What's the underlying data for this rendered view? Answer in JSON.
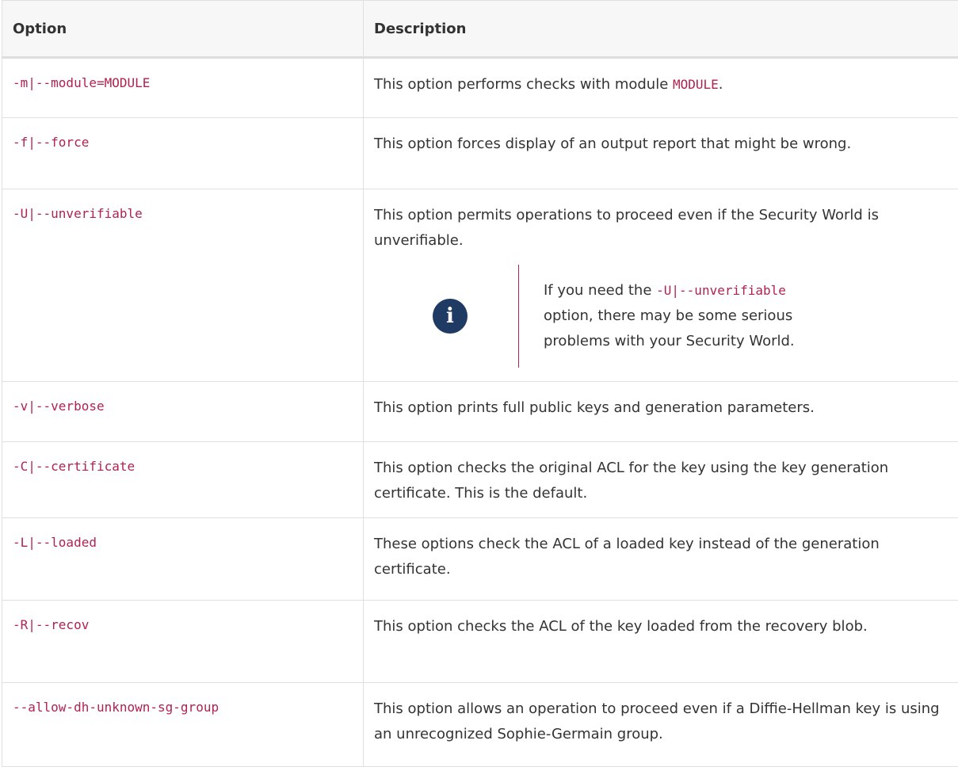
{
  "table": {
    "headers": [
      "Option",
      "Description"
    ],
    "rows": [
      {
        "option": "-m|--module=MODULE",
        "description_prefix": "This option performs checks with module ",
        "description_code": "MODULE",
        "description_suffix": "."
      },
      {
        "option": "-f|--force",
        "description": "This option forces display of an output report that might be wrong."
      },
      {
        "option": "-U|--unverifiable",
        "description": "This option permits operations to proceed even if the Security World is unverifiable.",
        "note": {
          "icon": "info-icon",
          "prefix": "If you need the ",
          "code": "-U|--unverifiable",
          "suffix": " option, there may be some serious problems with your Security World."
        }
      },
      {
        "option": "-v|--verbose",
        "description": "This option prints full public keys and generation parameters."
      },
      {
        "option": "-C|--certificate",
        "description": "This option checks the original ACL for the key using the key generation certificate. This is the default."
      },
      {
        "option": "-L|--loaded",
        "description": "These options check the ACL of a loaded key instead of the generation certificate."
      },
      {
        "option": "-R|--recov",
        "description": "This option checks the ACL of the key loaded from the recovery blob."
      },
      {
        "option": "--allow-dh-unknown-sg-group",
        "description": "This option allows an operation to proceed even if a Diffie-Hellman key is using an unrecognized Sophie-Germain group."
      }
    ]
  },
  "colors": {
    "code": "#b0224f",
    "text": "#333333",
    "header_bg": "#f7f7f7",
    "border": "#e0e0e0",
    "note_icon_bg": "#1f3a63"
  }
}
